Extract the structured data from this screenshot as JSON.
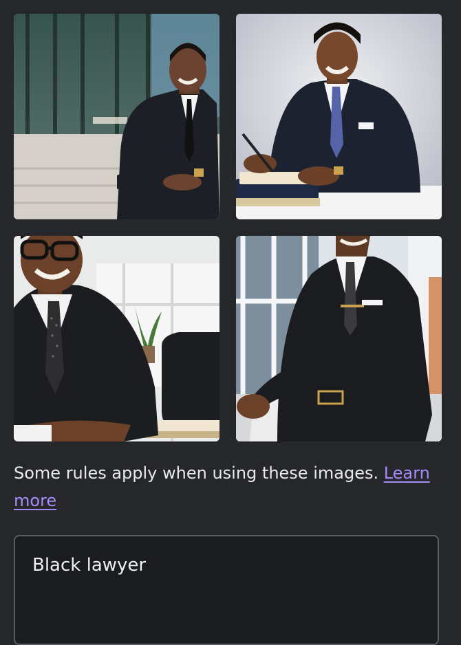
{
  "results": {
    "images": [
      {
        "alt": "Smiling man in suit seated outdoors near glass building",
        "icon": "generated-image"
      },
      {
        "alt": "Smiling man in suit writing at a desk",
        "icon": "generated-image"
      },
      {
        "alt": "Smiling man with glasses in suit at office desk",
        "icon": "generated-image"
      },
      {
        "alt": "Man in suit leaning against desk outside office",
        "icon": "generated-image"
      }
    ]
  },
  "notice": {
    "text": "Some rules apply when using these images. ",
    "link_label": "Learn more"
  },
  "prompt": {
    "value": "Black lawyer"
  },
  "colors": {
    "background": "#25272a",
    "link": "#a78bfa",
    "input_background": "#1b1c1f",
    "input_border": "#5a5d63"
  }
}
